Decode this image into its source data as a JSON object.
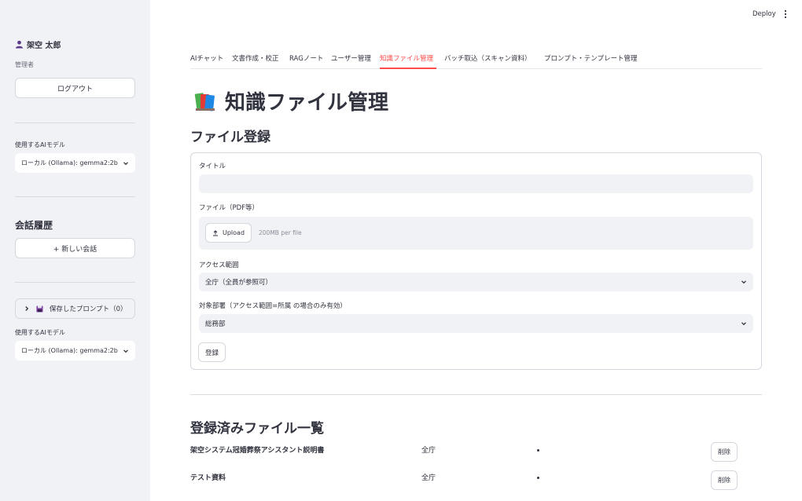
{
  "header": {
    "deploy_label": "Deploy"
  },
  "sidebar": {
    "user_name": "架空 太郎",
    "role": "管理者",
    "logout_label": "ログアウト",
    "model_label": "使用するAIモデル",
    "model_value": "ローカル (Ollama): gemma2:2b",
    "history_heading": "会話履歴",
    "new_chat_label": "+ 新しい会話",
    "saved_prompts_label": "保存したプロンプト（0）",
    "model_label_2": "使用するAIモデル",
    "model_value_2": "ローカル (Ollama): gemma2:2b"
  },
  "tabs": [
    {
      "label": "AIチャット"
    },
    {
      "label": "文書作成・校正"
    },
    {
      "label": "RAGノート"
    },
    {
      "label": "ユーザー管理"
    },
    {
      "label": "知識ファイル管理"
    },
    {
      "label": "バッチ取込（スキャン資料）"
    },
    {
      "label": "プロンプト・テンプレート管理"
    }
  ],
  "active_tab": "知識ファイル管理",
  "main": {
    "page_title": "知識ファイル管理",
    "register_heading": "ファイル登録",
    "form": {
      "title_label": "タイトル",
      "title_value": "",
      "file_label": "ファイル（PDF等）",
      "upload_label": "Upload",
      "upload_hint": "200MB per file",
      "access_label": "アクセス範囲",
      "access_value": "全庁（全員が参照可）",
      "dept_label": "対象部署（アクセス範囲=所属 の場合のみ有効）",
      "dept_value": "総務部",
      "submit_label": "登録"
    },
    "list_heading": "登録済みファイル一覧",
    "files": [
      {
        "title": "架空システム冠婚葬祭アシスタント説明書",
        "scope": "全庁",
        "delete_label": "削除"
      },
      {
        "title": "テスト資料",
        "scope": "全庁",
        "delete_label": "削除"
      }
    ]
  },
  "colors": {
    "accent": "#ff4b4b",
    "sidebar_bg": "#f0f2f6",
    "text": "#31333f"
  }
}
